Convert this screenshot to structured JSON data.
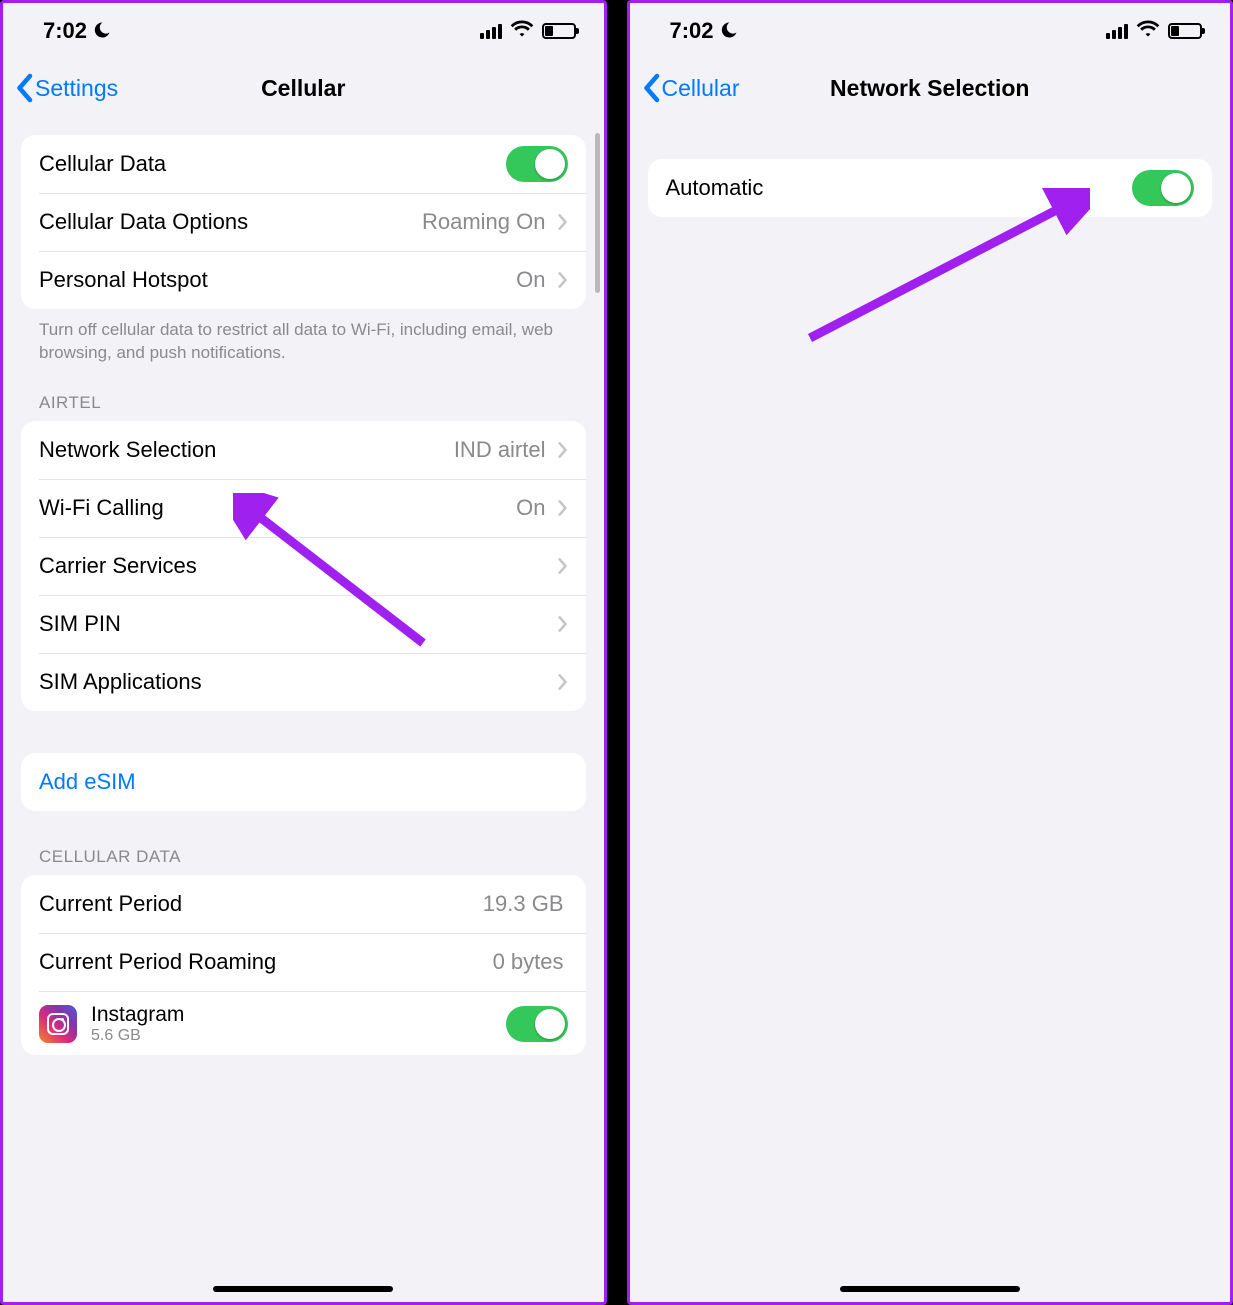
{
  "status": {
    "time": "7:02"
  },
  "left": {
    "back": "Settings",
    "title": "Cellular",
    "group1": {
      "cellular_data": "Cellular Data",
      "cellular_data_options": "Cellular Data Options",
      "cellular_data_options_value": "Roaming On",
      "personal_hotspot": "Personal Hotspot",
      "personal_hotspot_value": "On"
    },
    "footer1": "Turn off cellular data to restrict all data to Wi-Fi, including email, web browsing, and push notifications.",
    "airtel_header": "AIRTEL",
    "group2": {
      "network_selection": "Network Selection",
      "network_selection_value": "IND airtel",
      "wifi_calling": "Wi-Fi Calling",
      "wifi_calling_value": "On",
      "carrier_services": "Carrier Services",
      "sim_pin": "SIM PIN",
      "sim_applications": "SIM Applications"
    },
    "add_esim": "Add eSIM",
    "cellular_data_header": "CELLULAR DATA",
    "group4": {
      "current_period": "Current Period",
      "current_period_value": "19.3 GB",
      "current_period_roaming": "Current Period Roaming",
      "current_period_roaming_value": "0 bytes",
      "instagram": "Instagram",
      "instagram_size": "5.6 GB"
    }
  },
  "right": {
    "back": "Cellular",
    "title": "Network Selection",
    "automatic": "Automatic"
  }
}
